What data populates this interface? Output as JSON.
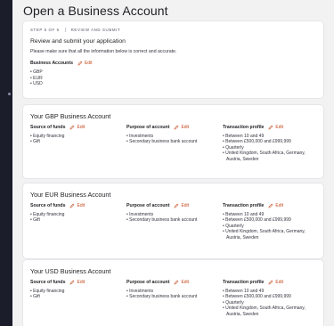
{
  "page": {
    "title": "Open a Business Account"
  },
  "step": {
    "step_label": "STEP 5 OF 5",
    "step_name": "REVIEW AND SUBMIT",
    "title": "Review and submit your application",
    "description": "Please make sure that all the information below is correct and accurate.",
    "business_accounts_label": "Business Accounts",
    "edit_label": "Edit",
    "currencies": [
      "• GBP",
      "• EUR",
      "• USD"
    ]
  },
  "labels": {
    "source_of_funds": "Source of funds",
    "purpose_of_account": "Purpose of account",
    "transaction_profile": "Transaction profile",
    "edit": "Edit"
  },
  "accounts": [
    {
      "title": "Your GBP Business Account",
      "source_of_funds": [
        "• Equity financing",
        "• Gift"
      ],
      "purpose": [
        "• Investments",
        "• Secondary business bank account"
      ],
      "transaction_profile": [
        "• Between 10 and 49",
        "• Between £500,000 and £999,999",
        "• Quarterly",
        "• United Kingdom, South Africa, Germany,",
        "Austria, Sweden"
      ]
    },
    {
      "title": "Your EUR Business Account",
      "source_of_funds": [
        "• Equity financing",
        "• Gift"
      ],
      "purpose": [
        "• Investments",
        "• Secondary business bank account"
      ],
      "transaction_profile": [
        "• Between 10 and 49",
        "• Between £500,000 and £999,999",
        "• Quarterly",
        "• United Kingdom, South Africa, Germany,",
        "Austria, Sweden"
      ]
    },
    {
      "title": "Your USD Business Account",
      "source_of_funds": [
        "• Equity financing",
        "• Gift"
      ],
      "purpose": [
        "• Investments",
        "• Secondary business bank account"
      ],
      "transaction_profile": [
        "• Between 10 and 49",
        "• Between £500,000 and £999,999",
        "• Quarterly",
        "• United Kingdom, South Africa, Germany,",
        "Austria, Sweden"
      ]
    }
  ],
  "colors": {
    "accent": "#c24a1c",
    "sidebar": "#1c1d2b",
    "background": "#f2f2f3"
  },
  "icons": {
    "edit": "pencil-icon"
  }
}
